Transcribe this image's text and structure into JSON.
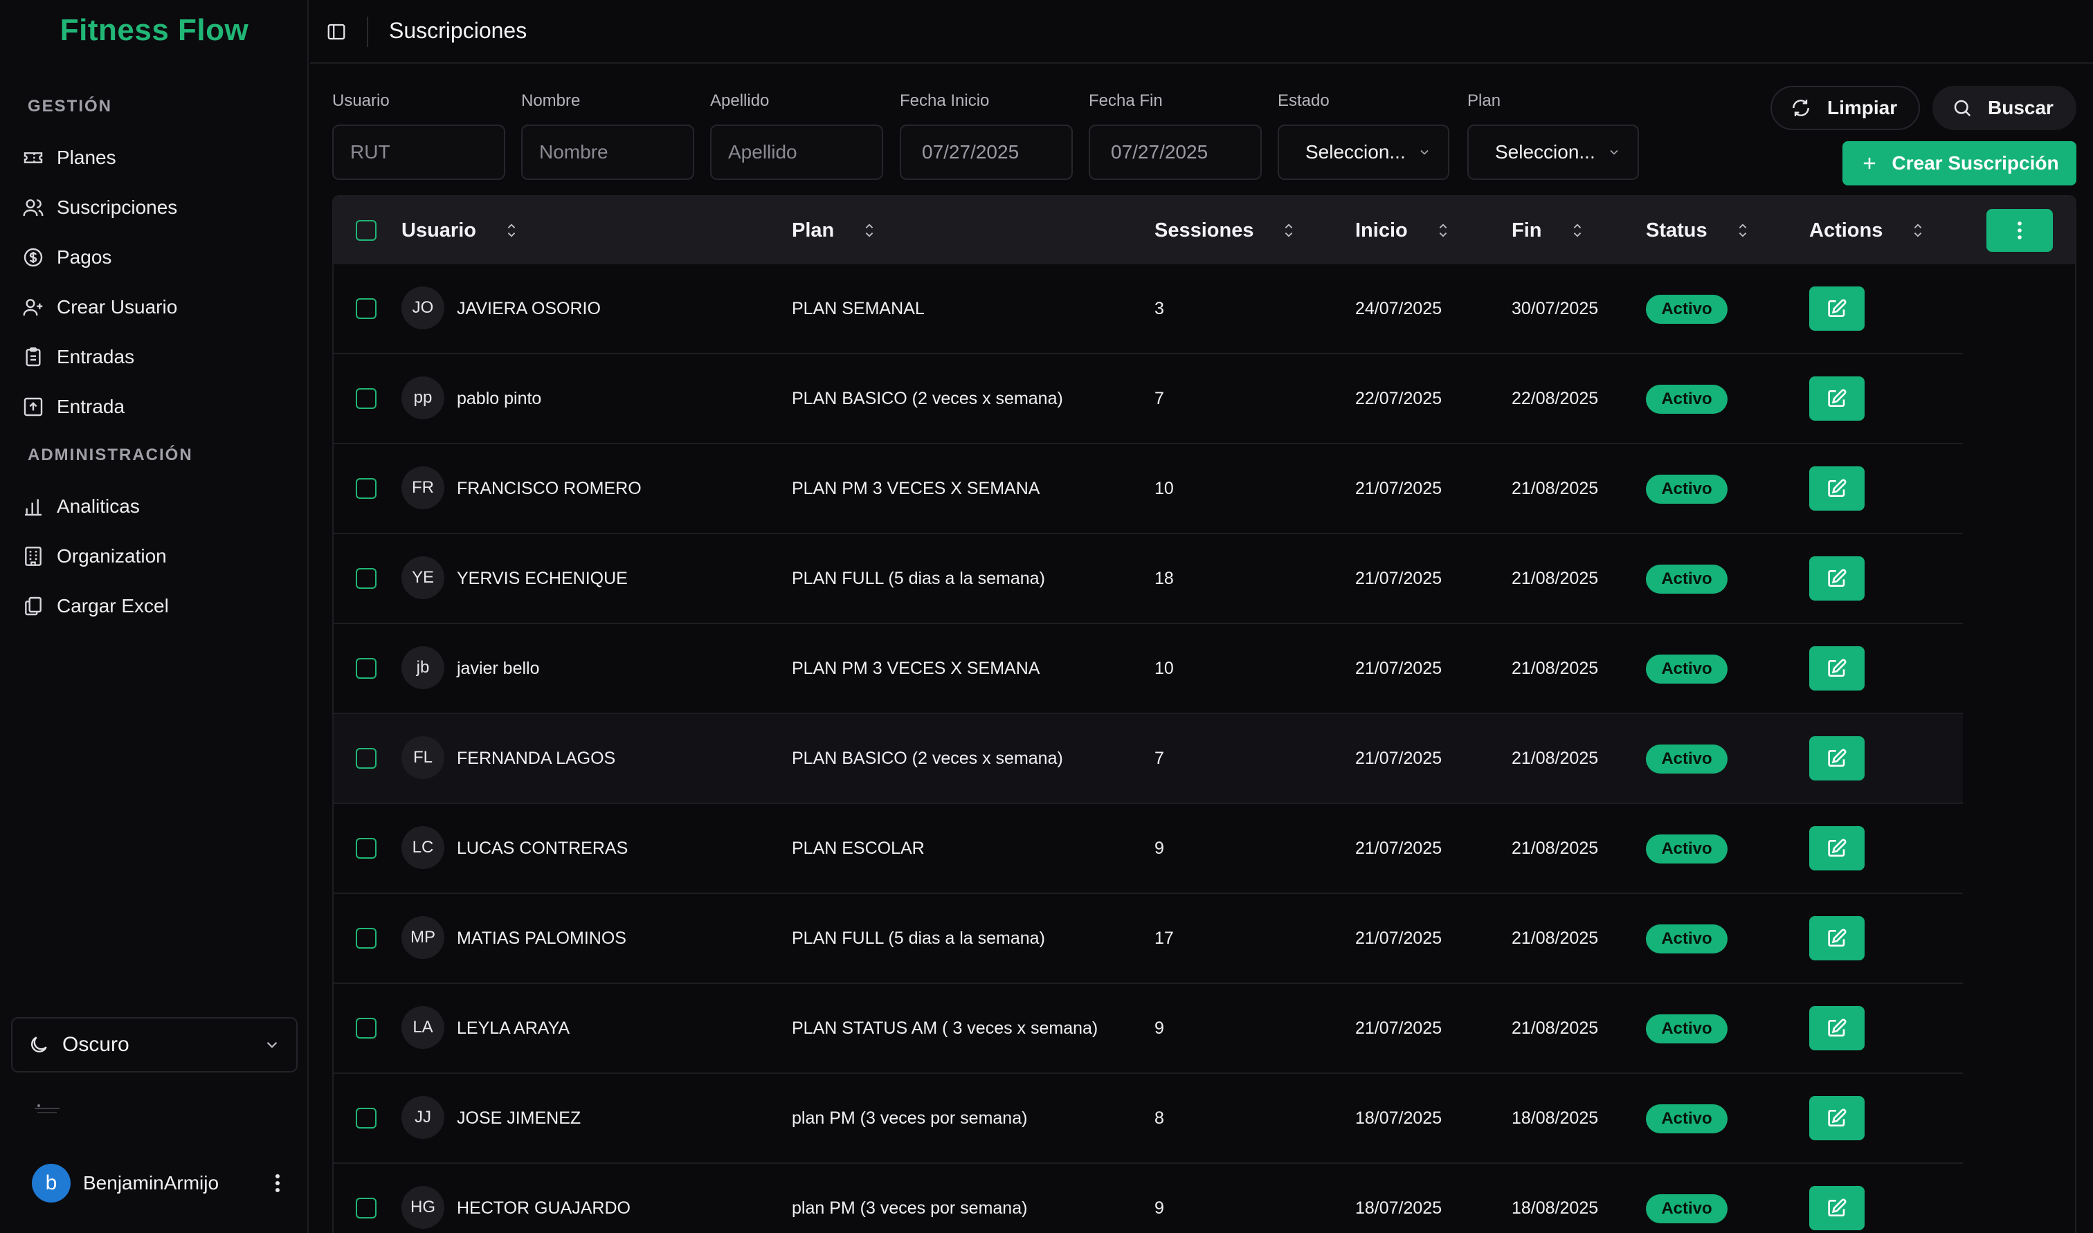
{
  "sidebar": {
    "brand": "Fitness Flow",
    "sections": [
      {
        "title": "GESTIÓN"
      },
      {
        "title": "ADMINISTRACIÓN"
      }
    ],
    "items": [
      {
        "label": "Planes",
        "icon": "ticket-icon"
      },
      {
        "label": "Suscripciones",
        "icon": "users-icon"
      },
      {
        "label": "Pagos",
        "icon": "dollar-circle-icon"
      },
      {
        "label": "Crear Usuario",
        "icon": "user-plus-icon"
      },
      {
        "label": "Entradas",
        "icon": "clipboard-icon"
      },
      {
        "label": "Entrada",
        "icon": "upload-icon"
      },
      {
        "label": "Analiticas",
        "icon": "bar-chart-icon"
      },
      {
        "label": "Organization",
        "icon": "building-icon"
      },
      {
        "label": "Cargar Excel",
        "icon": "files-icon"
      }
    ],
    "theme": "Oscuro",
    "user": {
      "initial": "b",
      "name": "BenjaminArmijo"
    }
  },
  "header": {
    "title": "Suscripciones"
  },
  "filters": {
    "usuario_label": "Usuario",
    "usuario_placeholder": "RUT",
    "nombre_label": "Nombre",
    "nombre_placeholder": "Nombre",
    "apellido_label": "Apellido",
    "apellido_placeholder": "Apellido",
    "fecha_inicio_label": "Fecha Inicio",
    "fecha_inicio_value": "07/27/2025",
    "fecha_fin_label": "Fecha Fin",
    "fecha_fin_value": "07/27/2025",
    "estado_label": "Estado",
    "estado_value": "Seleccion...",
    "plan_label": "Plan",
    "plan_value": "Seleccion...",
    "clear_label": "Limpiar",
    "search_label": "Buscar",
    "create_label": "Crear Suscripción"
  },
  "table": {
    "columns": [
      "Usuario",
      "Plan",
      "Sessiones",
      "Inicio",
      "Fin",
      "Status",
      "Actions"
    ],
    "rows": [
      {
        "initials": "JO",
        "name": "JAVIERA OSORIO",
        "plan": "PLAN SEMANAL",
        "sessions": "3",
        "start": "24/07/2025",
        "end": "30/07/2025",
        "status": "Activo"
      },
      {
        "initials": "pp",
        "name": "pablo pinto",
        "plan": "PLAN BASICO (2 veces x semana)",
        "sessions": "7",
        "start": "22/07/2025",
        "end": "22/08/2025",
        "status": "Activo"
      },
      {
        "initials": "FR",
        "name": "FRANCISCO ROMERO",
        "plan": "PLAN PM 3 VECES X SEMANA",
        "sessions": "10",
        "start": "21/07/2025",
        "end": "21/08/2025",
        "status": "Activo"
      },
      {
        "initials": "YE",
        "name": "YERVIS ECHENIQUE",
        "plan": "PLAN FULL (5 dias a la semana)",
        "sessions": "18",
        "start": "21/07/2025",
        "end": "21/08/2025",
        "status": "Activo"
      },
      {
        "initials": "jb",
        "name": "javier bello",
        "plan": "PLAN PM 3 VECES X SEMANA",
        "sessions": "10",
        "start": "21/07/2025",
        "end": "21/08/2025",
        "status": "Activo"
      },
      {
        "initials": "FL",
        "name": "FERNANDA LAGOS",
        "plan": "PLAN BASICO (2 veces x semana)",
        "sessions": "7",
        "start": "21/07/2025",
        "end": "21/08/2025",
        "status": "Activo"
      },
      {
        "initials": "LC",
        "name": "LUCAS CONTRERAS",
        "plan": "PLAN ESCOLAR",
        "sessions": "9",
        "start": "21/07/2025",
        "end": "21/08/2025",
        "status": "Activo"
      },
      {
        "initials": "MP",
        "name": "MATIAS PALOMINOS",
        "plan": "PLAN FULL (5 dias a la semana)",
        "sessions": "17",
        "start": "21/07/2025",
        "end": "21/08/2025",
        "status": "Activo"
      },
      {
        "initials": "LA",
        "name": "LEYLA ARAYA",
        "plan": "PLAN STATUS AM ( 3 veces x semana)",
        "sessions": "9",
        "start": "21/07/2025",
        "end": "21/08/2025",
        "status": "Activo"
      },
      {
        "initials": "JJ",
        "name": "JOSE JIMENEZ",
        "plan": "plan PM (3 veces por semana)",
        "sessions": "8",
        "start": "18/07/2025",
        "end": "18/08/2025",
        "status": "Activo"
      },
      {
        "initials": "HG",
        "name": "HECTOR GUAJARDO",
        "plan": "plan PM (3 veces por semana)",
        "sessions": "9",
        "start": "18/07/2025",
        "end": "18/08/2025",
        "status": "Activo"
      }
    ]
  },
  "colors": {
    "accent": "#15b37a",
    "brand": "#21b776",
    "background": "#0a0a0c",
    "header_row": "#1b1b20"
  }
}
